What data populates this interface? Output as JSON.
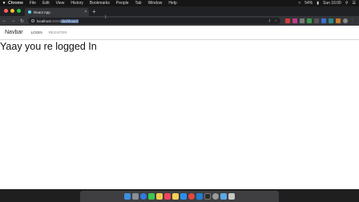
{
  "menubar": {
    "apple": "",
    "app_name": "Chrome",
    "items": [
      "File",
      "Edit",
      "View",
      "History",
      "Bookmarks",
      "People",
      "Tab",
      "Window",
      "Help"
    ],
    "battery": "54%",
    "clock": "Sun 16:00"
  },
  "tab": {
    "title": "React App",
    "close": "×",
    "new_tab": "+"
  },
  "omnibox": {
    "host": "localhost",
    "port": ":3000/",
    "path": "dashboard"
  },
  "page": {
    "navbar": {
      "brand": "Navbar",
      "links": [
        "LOGIN",
        "REGISTER"
      ]
    },
    "headline": "Yaay you re logged In"
  },
  "colors": {
    "close_light": "#ff5f57",
    "minimize_light": "#febc2e",
    "zoom_light": "#28c840",
    "selection": "#3d5a8a"
  },
  "dock": {
    "icons": [
      "finder-icon",
      "launchpad-icon",
      "safari-icon",
      "messages-icon",
      "photos-icon",
      "music-icon",
      "notes-icon",
      "app-store-icon",
      "chrome-icon",
      "vscode-icon",
      "terminal-icon",
      "preferences-icon",
      "folder-icon",
      "trash-icon"
    ]
  }
}
